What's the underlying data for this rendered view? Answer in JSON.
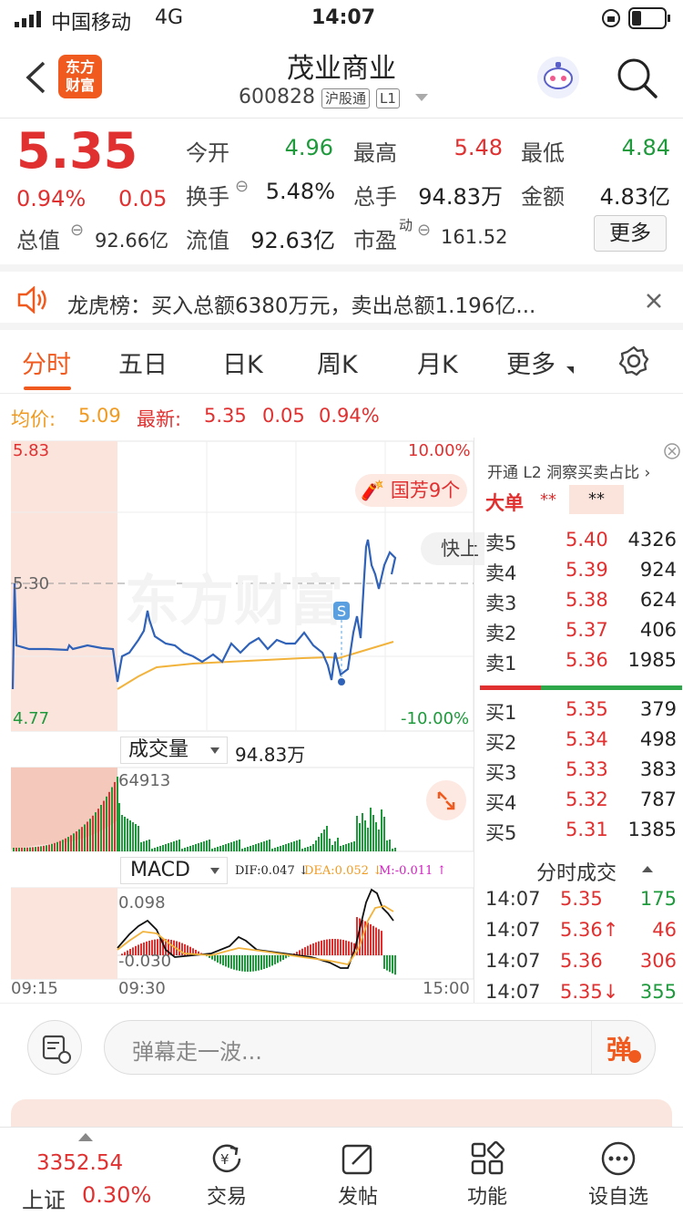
{
  "status": {
    "carrier": "中国移动",
    "network": "4G",
    "time": "14:07"
  },
  "header": {
    "title": "茂业商业",
    "code": "600828",
    "tag1": "沪股通",
    "tag2": "L1",
    "logo": "东方\n财富"
  },
  "quote": {
    "price": "5.35",
    "pct": "0.94%",
    "chg": "0.05",
    "open_label": "今开",
    "open": "4.96",
    "high_label": "最高",
    "high": "5.48",
    "low_label": "最低",
    "low": "4.84",
    "turnover_label": "换手",
    "turnover": "5.48%",
    "volume_label": "总手",
    "volume": "94.83万",
    "amount_label": "金额",
    "amount": "4.83亿",
    "mktcap_label": "总值",
    "mktcap": "92.66亿",
    "float_label": "流值",
    "float": "92.63亿",
    "pe_label": "市盈",
    "pe_sup": "动",
    "pe": "161.52",
    "more_button": "更多"
  },
  "notice": {
    "text": "龙虎榜：买入总额6380万元，卖出总额1.196亿..."
  },
  "tabs": [
    {
      "label": "分时"
    },
    {
      "label": "五日"
    },
    {
      "label": "日K"
    },
    {
      "label": "周K"
    },
    {
      "label": "月K"
    },
    {
      "label": "更多"
    }
  ],
  "avgline": {
    "avg_label": "均价:",
    "avg": "5.09",
    "latest_label": "最新:",
    "latest": "5.35",
    "chg": "0.05",
    "pct": "0.94%"
  },
  "chart": {
    "ymax": "5.83",
    "ymid": "5.30",
    "ymin": "4.77",
    "pmax": "10.00%",
    "pmin": "-10.00%",
    "badge": "国芳9个",
    "fast_label": "快上",
    "vol_selector": "成交量",
    "vol_total": "94.83万",
    "vol_max": "64913",
    "macd_selector": "MACD",
    "dif": "DIF:0.047",
    "dea": "DEA:0.052",
    "m": "M:-0.011",
    "macd_top": "0.098",
    "macd_bottom": "-0.030",
    "t1": "09:15",
    "t2": "09:30",
    "t3": "15:00",
    "s_marker": "S"
  },
  "book": {
    "l2_link": "开通 L2 洞察买卖占比",
    "big_order_label": "大单",
    "big_order_a": "**",
    "big_order_b": "**",
    "asks": [
      {
        "label": "卖5",
        "price": "5.40",
        "vol": "4326"
      },
      {
        "label": "卖4",
        "price": "5.39",
        "vol": "924"
      },
      {
        "label": "卖3",
        "price": "5.38",
        "vol": "624"
      },
      {
        "label": "卖2",
        "price": "5.37",
        "vol": "406"
      },
      {
        "label": "卖1",
        "price": "5.36",
        "vol": "1985"
      }
    ],
    "bids": [
      {
        "label": "买1",
        "price": "5.35",
        "vol": "379"
      },
      {
        "label": "买2",
        "price": "5.34",
        "vol": "498"
      },
      {
        "label": "买3",
        "price": "5.33",
        "vol": "383"
      },
      {
        "label": "买4",
        "price": "5.32",
        "vol": "787"
      },
      {
        "label": "买5",
        "price": "5.31",
        "vol": "1385"
      }
    ],
    "ticks_title": "分时成交",
    "ticks": [
      {
        "time": "14:07",
        "price": "5.35",
        "vol": "175"
      },
      {
        "time": "14:07",
        "price": "5.36↑",
        "vol": "46"
      },
      {
        "time": "14:07",
        "price": "5.36",
        "vol": "306"
      },
      {
        "time": "14:07",
        "price": "5.35↓",
        "vol": "355"
      }
    ]
  },
  "input": {
    "placeholder": "弹幕走一波...",
    "danmu": "弹"
  },
  "tabbar": {
    "index_value": "3352.54",
    "index_name": "上证",
    "index_pct": "0.30%",
    "trade": "交易",
    "post": "发帖",
    "func": "功能",
    "custom": "设自选"
  }
}
